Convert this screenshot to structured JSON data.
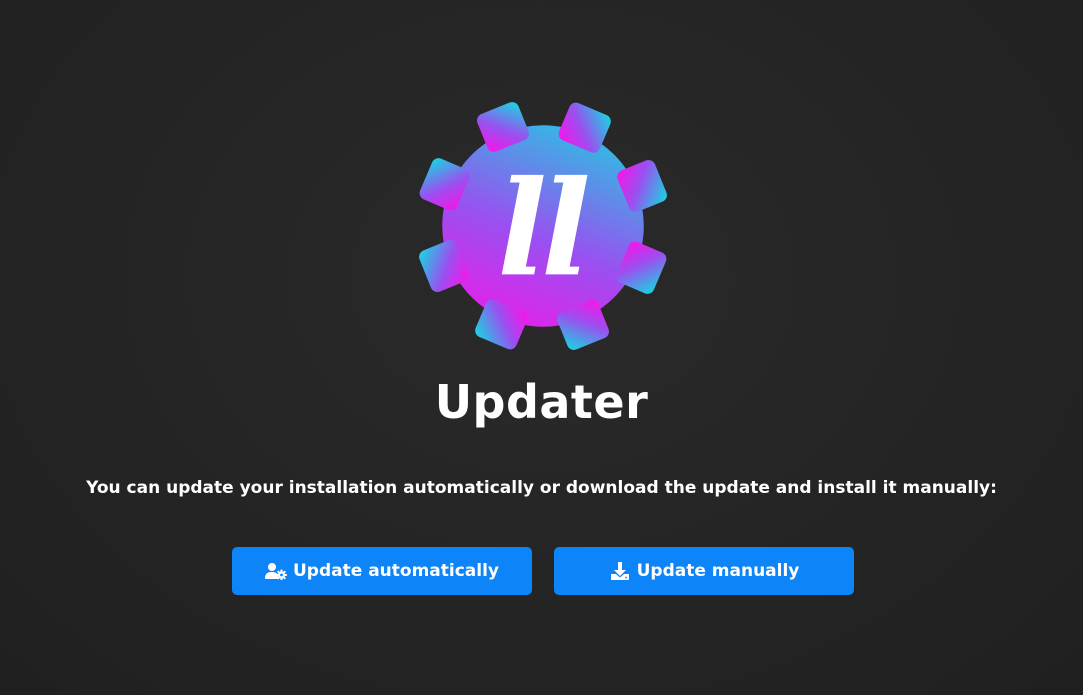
{
  "header": {
    "logo_letters": "ll",
    "title": "Updater"
  },
  "main": {
    "description": "You can update your installation automatically or download the update and install it manually:"
  },
  "actions": {
    "auto": {
      "label": "Update automatically",
      "icon": "user-gear-icon"
    },
    "manual": {
      "label": "Update manually",
      "icon": "download-icon"
    }
  },
  "colors": {
    "background": "#242424",
    "button": "#0d84f7",
    "logo_gradient_start": "#f01ee6",
    "logo_gradient_end": "#1ed8e0",
    "text": "#ffffff"
  }
}
